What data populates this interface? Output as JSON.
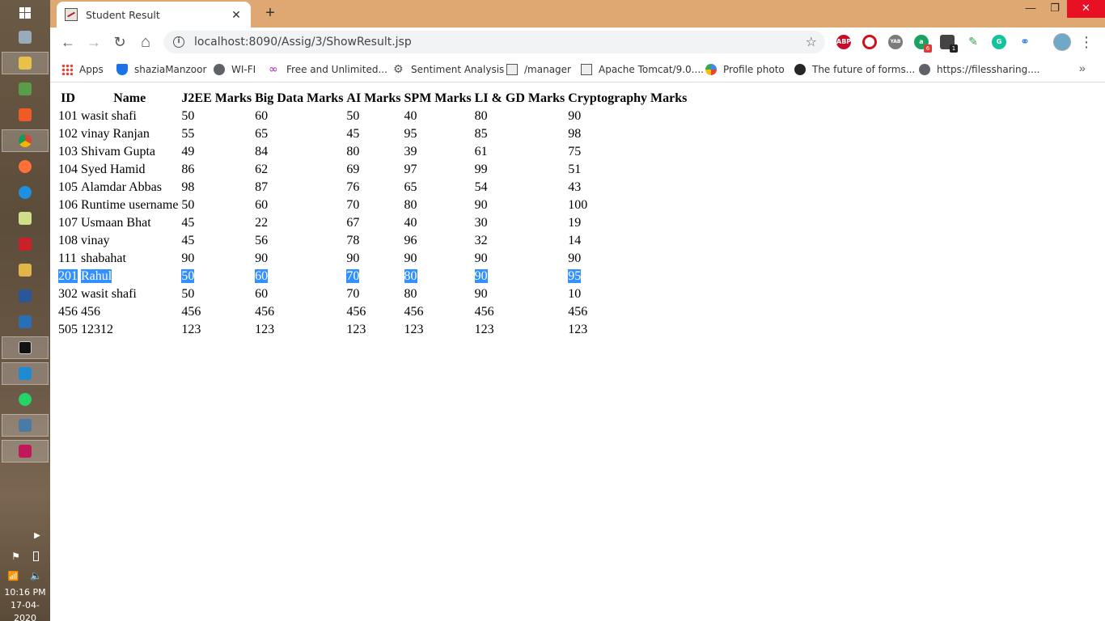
{
  "browser": {
    "tab_title": "Student Result",
    "tab_close": "✕",
    "new_tab": "+",
    "url": "localhost:8090/Assig/3/ShowResult.jsp",
    "window_controls": {
      "minimize": "—",
      "restore": "❐",
      "close": "✕"
    }
  },
  "toolbar": {
    "back": "←",
    "forward": "→",
    "reload": "↻",
    "home": "⌂",
    "star": "☆",
    "menu": "⋮",
    "extensions": [
      {
        "name": "abp",
        "label": "ABP"
      },
      {
        "name": "block",
        "label": ""
      },
      {
        "name": "yab",
        "label": "YAB"
      },
      {
        "name": "a",
        "label": "a",
        "badge": "6"
      },
      {
        "name": "cam",
        "label": "",
        "badge": "1"
      },
      {
        "name": "pen",
        "label": "✎"
      },
      {
        "name": "g",
        "label": "G"
      },
      {
        "name": "link",
        "label": "⚭"
      }
    ]
  },
  "bookmarks": {
    "items": [
      {
        "label": "Apps",
        "icon": "apps-grid-icon"
      },
      {
        "label": "shaziaManzoor",
        "icon": "shield-icon"
      },
      {
        "label": "WI-FI",
        "icon": "globe-icon"
      },
      {
        "label": "Free and Unlimited...",
        "icon": "infinity-icon"
      },
      {
        "label": "Sentiment Analysis",
        "icon": "gear-cluster-icon"
      },
      {
        "label": "/manager",
        "icon": "tomcat-icon"
      },
      {
        "label": "Apache Tomcat/9.0....",
        "icon": "tomcat-icon"
      },
      {
        "label": "Profile photo",
        "icon": "pinwheel-icon"
      },
      {
        "label": "The future of forms...",
        "icon": "typeform-icon"
      },
      {
        "label": "https://filessharing....",
        "icon": "globe-icon"
      }
    ],
    "more": "»"
  },
  "table": {
    "headers": [
      "ID",
      "Name",
      "J2EE Marks",
      "Big Data Marks",
      "AI Marks",
      "SPM Marks",
      "LI & GD Marks",
      "Cryptography Marks"
    ],
    "rows": [
      [
        "101",
        "wasit shafi",
        "50",
        "60",
        "50",
        "40",
        "80",
        "90"
      ],
      [
        "102",
        "vinay Ranjan",
        "55",
        "65",
        "45",
        "95",
        "85",
        "98"
      ],
      [
        "103",
        "Shivam Gupta",
        "49",
        "84",
        "80",
        "39",
        "61",
        "75"
      ],
      [
        "104",
        "Syed Hamid",
        "86",
        "62",
        "69",
        "97",
        "99",
        "51"
      ],
      [
        "105",
        "Alamdar Abbas",
        "98",
        "87",
        "76",
        "65",
        "54",
        "43"
      ],
      [
        "106",
        "Runtime username",
        "50",
        "60",
        "70",
        "80",
        "90",
        "100"
      ],
      [
        "107",
        "Usmaan Bhat",
        "45",
        "22",
        "67",
        "40",
        "30",
        "19"
      ],
      [
        "108",
        "vinay",
        "45",
        "56",
        "78",
        "96",
        "32",
        "14"
      ],
      [
        "111",
        "shabahat",
        "90",
        "90",
        "90",
        "90",
        "90",
        "90"
      ],
      [
        "201",
        "Rahul",
        "50",
        "60",
        "70",
        "80",
        "90",
        "95"
      ],
      [
        "302",
        "wasit shafi",
        "50",
        "60",
        "70",
        "80",
        "90",
        "10"
      ],
      [
        "456",
        "456",
        "456",
        "456",
        "456",
        "456",
        "456",
        "456"
      ],
      [
        "505",
        "12312",
        "123",
        "123",
        "123",
        "123",
        "123",
        "123"
      ]
    ],
    "selected_row_index": 9
  },
  "taskbar": {
    "time": "10:16 PM",
    "date": "17-04-2020"
  }
}
